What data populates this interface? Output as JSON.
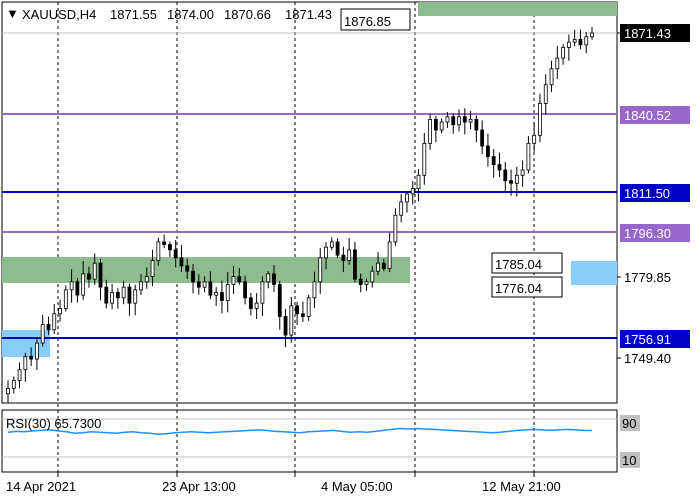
{
  "header": {
    "symbol": "XAUUSD,H4",
    "open": "1871.55",
    "high": "1874.00",
    "low": "1870.66",
    "close": "1871.43"
  },
  "colors": {
    "support_line": "#0000c8",
    "resistance_line": "#9966cc",
    "green_zone": "#8fbc8f",
    "blue_zone": "#87cefa",
    "rsi_line": "#1e90ff",
    "candle": "#000000"
  },
  "price_labels": {
    "current": "1871.43",
    "r1": "1840.52",
    "s_mid": "1811.50",
    "r2": "1796.30",
    "axis_mid": "1779.85",
    "s_low": "1756.91",
    "axis_low": "1749.40"
  },
  "annotations": {
    "target_top": "1876.85",
    "zone_high": "1785.04",
    "zone_low": "1776.04"
  },
  "rsi": {
    "title": "RSI(30) 65.7300",
    "level_high": "90",
    "level_low": "10"
  },
  "time_labels": [
    "14 Apr 2021",
    "23 Apr 13:00",
    "4 May 05:00",
    "12 May 21:00"
  ],
  "chart_data": [
    {
      "type": "candlestick",
      "title": "XAUUSD,H4",
      "ylim": [
        1735,
        1885
      ],
      "x": [
        "14 Apr 2021",
        "23 Apr 13:00",
        "4 May 05:00",
        "12 May 21:00"
      ],
      "horizontal_levels": [
        1876.85,
        1840.52,
        1811.5,
        1796.3,
        1785.04,
        1776.04,
        1756.91
      ],
      "series": [
        {
          "values": [
            1738,
            1741,
            1745,
            1750,
            1749,
            1755,
            1762,
            1760,
            1766,
            1768,
            1775,
            1778,
            1773,
            1781,
            1779,
            1785,
            1776,
            1770,
            1774,
            1772,
            1776,
            1770,
            1775,
            1778,
            1780,
            1786,
            1793,
            1792,
            1790,
            1787,
            1784,
            1782,
            1778,
            1776,
            1778,
            1773,
            1774,
            1771,
            1777,
            1780,
            1778,
            1772,
            1768,
            1770,
            1778,
            1781,
            1777,
            1765,
            1758,
            1769,
            1766,
            1765,
            1772,
            1778,
            1787,
            1791,
            1793,
            1788,
            1786,
            1790,
            1779,
            1777,
            1778,
            1782,
            1785,
            1783,
            1793,
            1803,
            1808,
            1811,
            1813,
            1818,
            1830,
            1839,
            1835,
            1838,
            1840,
            1837,
            1840,
            1838,
            1839,
            1835,
            1829,
            1825,
            1822,
            1820,
            1816,
            1815,
            1818,
            1820,
            1830,
            1833,
            1845,
            1852,
            1858,
            1862,
            1866,
            1868,
            1869,
            1867,
            1870,
            1871.43
          ]
        }
      ]
    },
    {
      "type": "line",
      "title": "RSI(30) 65.7300",
      "ylim": [
        0,
        100
      ],
      "series": [
        {
          "values": [
            62,
            64,
            63,
            65,
            66,
            67,
            65,
            63,
            60,
            61,
            63,
            62,
            61,
            60,
            62,
            63,
            61,
            60,
            58,
            59,
            61,
            62,
            63,
            62,
            61,
            62,
            63,
            64,
            65,
            66,
            67,
            66,
            64,
            63,
            62,
            61,
            63,
            64,
            65,
            66,
            64,
            62,
            63,
            62,
            64,
            66,
            68,
            70,
            69,
            70,
            69,
            68,
            67,
            66,
            65,
            64,
            63,
            62,
            61,
            62,
            64,
            66,
            67,
            68,
            67,
            66,
            67,
            68,
            67,
            66,
            65.73
          ]
        }
      ],
      "levels": [
        90,
        10
      ]
    }
  ]
}
